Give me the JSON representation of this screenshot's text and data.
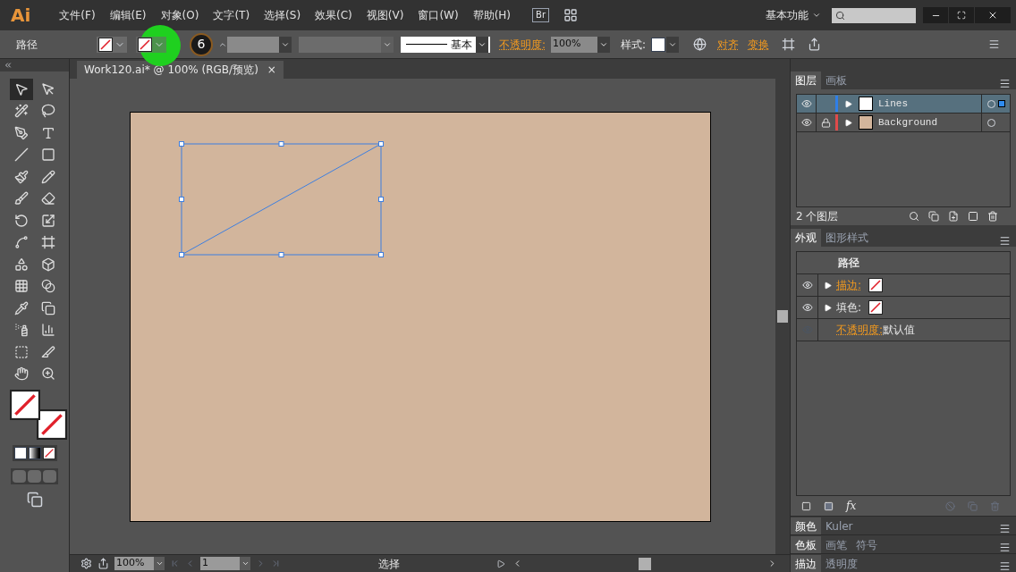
{
  "app": {
    "logo": "Ai"
  },
  "menu": [
    "文件(F)",
    "编辑(E)",
    "对象(O)",
    "文字(T)",
    "选择(S)",
    "效果(C)",
    "视图(V)",
    "窗口(W)",
    "帮助(H)"
  ],
  "bridge_button": "Br",
  "workspace": "基本功能",
  "control_bar": {
    "selection": "路径",
    "step_badge": "6",
    "stroke_style": "基本",
    "opacity_label": "不透明度:",
    "opacity": "100%",
    "style_label": "样式:",
    "align": "对齐",
    "transform": "变换"
  },
  "tools": [
    {
      "selected": true
    },
    {
      "selected": false
    },
    {
      "selected": false
    },
    {
      "selected": false
    },
    {
      "selected": false
    },
    {
      "selected": false
    },
    {
      "selected": false
    },
    {
      "selected": false
    },
    {
      "selected": false
    },
    {
      "selected": false
    },
    {
      "selected": false
    },
    {
      "selected": false
    },
    {
      "selected": false
    },
    {
      "selected": false
    },
    {
      "selected": false
    },
    {
      "selected": false
    },
    {
      "selected": false
    },
    {
      "selected": false
    },
    {
      "selected": false
    },
    {
      "selected": false
    },
    {
      "selected": false
    },
    {
      "selected": false
    },
    {
      "selected": false
    },
    {
      "selected": false
    },
    {
      "selected": false
    },
    {
      "selected": false
    },
    {
      "selected": false
    },
    {
      "selected": false
    }
  ],
  "document_tab": {
    "title": "Work120.ai* @ 100% (RGB/预览)",
    "close": "×"
  },
  "layers_panel": {
    "tabs": [
      {
        "label": "图层",
        "selected": true
      },
      {
        "label": "画板",
        "selected": false
      }
    ],
    "layers": [
      {
        "name": "Lines",
        "color": "#2f7fe8",
        "locked": false,
        "selected": true
      },
      {
        "name": "Background",
        "color": "#e04a4a",
        "locked": true,
        "selected": false
      }
    ],
    "count": "2 个图层"
  },
  "appearance_panel": {
    "tabs": [
      {
        "label": "外观",
        "selected": true
      },
      {
        "label": "图形样式",
        "selected": false
      }
    ],
    "title": "路径",
    "fx": "fx",
    "rows": [
      {
        "kind": "swatch",
        "label": "描边:",
        "link": true,
        "visible": true
      },
      {
        "kind": "swatch",
        "label": "填色:",
        "link": false,
        "visible": true
      },
      {
        "kind": "value",
        "label": "不透明度:",
        "value": "默认值",
        "link": true,
        "visible": false
      }
    ]
  },
  "collapsed_panels": [
    {
      "tabs": [
        {
          "label": "颜色",
          "selected": true
        },
        {
          "label": "Kuler",
          "selected": false
        }
      ]
    },
    {
      "tabs": [
        {
          "label": "色板",
          "selected": true
        },
        {
          "label": "画笔",
          "selected": false
        },
        {
          "label": "符号",
          "selected": false
        }
      ]
    },
    {
      "tabs": [
        {
          "label": "描边",
          "selected": true
        },
        {
          "label": "透明度",
          "selected": false
        }
      ]
    }
  ],
  "status_bar": {
    "zoom": "100%",
    "artboard": "1",
    "tool": "选择"
  }
}
